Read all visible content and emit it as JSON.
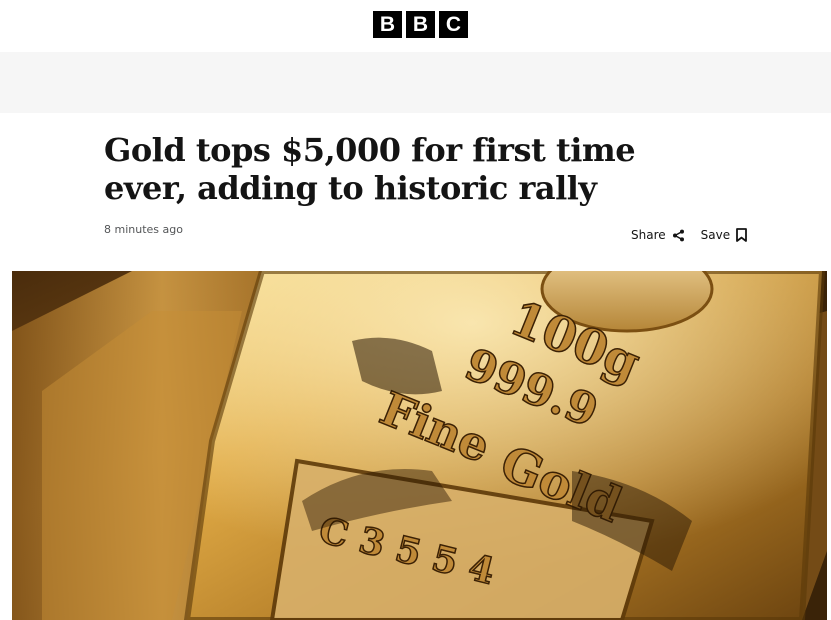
{
  "brand": {
    "letters": [
      "B",
      "B",
      "C"
    ]
  },
  "article": {
    "headline": "Gold tops $5,000 for first time ever, adding to historic rally",
    "timestamp": "8 minutes ago",
    "share_label": "Share",
    "save_label": "Save"
  },
  "hero_image": {
    "engraving": {
      "weight": "100g",
      "purity": "999.9",
      "line1": "Fine",
      "line2": "Gold",
      "serial": "C 3 5 5 4"
    }
  },
  "colors": {
    "brand_black": "#000000",
    "band_grey": "#f6f6f6",
    "gold": "#c9962f"
  }
}
